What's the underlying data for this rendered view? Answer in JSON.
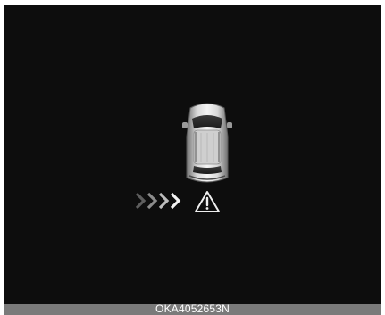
{
  "display": {
    "background_color": "#0d0d0d",
    "vehicle_icon": "vehicle-top-view-icon",
    "direction_icon": "chevrons-right-icon",
    "warning_icon": "warning-triangle-icon",
    "chevron_count": 4
  },
  "caption": {
    "code": "OKA4052653N",
    "bar_color": "#7a7a7a"
  }
}
